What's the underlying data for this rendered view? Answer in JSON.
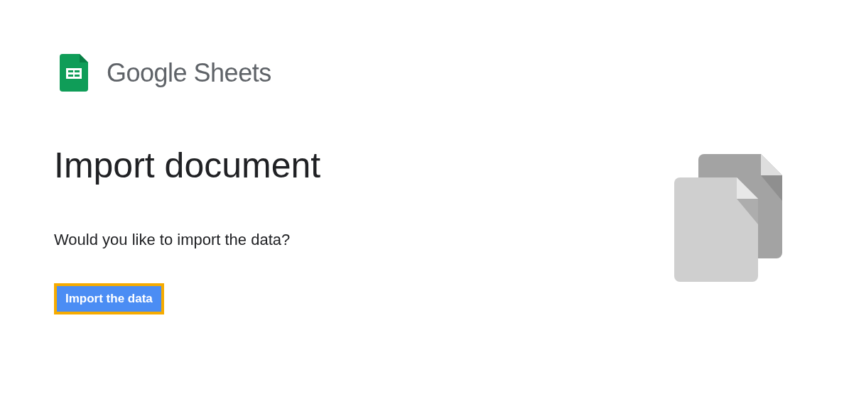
{
  "brand": {
    "name": "Google Sheets"
  },
  "heading": "Import document",
  "prompt": "Would you like to import the data?",
  "import_button": {
    "label": "Import the data",
    "focused": true
  }
}
